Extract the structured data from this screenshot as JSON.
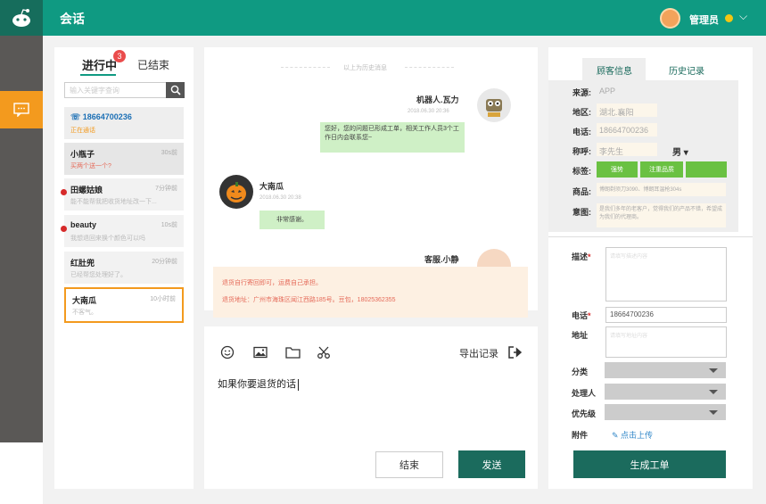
{
  "header": {
    "title": "会话",
    "admin_name": "管理员",
    "dropdown_icon": "chevron-down-icon",
    "status_color": "#f3c613"
  },
  "conv_tabs": {
    "active": "进行中",
    "badge": "3",
    "ended": "已结束"
  },
  "search": {
    "placeholder": "输入关键字查询"
  },
  "conversations": [
    {
      "name": "18664700236",
      "time": "",
      "msg": "正在通话"
    },
    {
      "name": "小瓶子",
      "time": "30s前",
      "msg": "买两个送一个?"
    },
    {
      "name": "田螺姑娘",
      "time": "7分钟前",
      "msg": "能不能帮我把收货地址改一下..."
    },
    {
      "name": "beauty",
      "time": "10s前",
      "msg": "我想退回来换个颜色可以吗"
    },
    {
      "name": "红肚兜",
      "time": "20分钟前",
      "msg": "已经帮您处理好了。"
    },
    {
      "name": "大南瓜",
      "time": "10小时前",
      "msg": "不客气。"
    }
  ],
  "chat": {
    "history_label": "以上为历史消息",
    "robot_name": "机器人.瓦力",
    "robot_time": "2018.06.30  20:36",
    "robot_msg": "您好，您的问题已形成工单，相关工作人员3个工作日内会联系您~",
    "user_name": "大南瓜",
    "user_time": "2018.06.30  20:38",
    "user_msg": "非常感谢。",
    "agent_name": "客服.小静",
    "notice_line1": "退货自行寄回即可，运费自己承担。",
    "notice_line2": "退货地址：广州市海珠区闻江西路185号。豆包，18025362355"
  },
  "composer": {
    "export_label": "导出记录",
    "draft": "如果你要退货的话",
    "end_label": "结束",
    "send_label": "发送"
  },
  "right_tabs": {
    "customer": "顾客信息",
    "history": "历史记录"
  },
  "customer": {
    "source_label": "来源:",
    "source": "APP",
    "region_label": "地区:",
    "region": "湖北.襄阳",
    "phone_label": "电话:",
    "phone": "18664700236",
    "title_label": "称呼:",
    "title": "李先生",
    "gender": "男",
    "tags_label": "标签:",
    "tags": [
      "强势",
      "注重品质",
      ""
    ],
    "product_label": "商品:",
    "product": "博朗剃须刀3090、博朗耳温枪304s",
    "intent_label": "意图:",
    "intent": "是我们多年的老客户，觉得我们的产品不错，希望成为我们的代理商。"
  },
  "ticket": {
    "desc_label": "描述",
    "desc_placeholder": "请填写描述内容",
    "phone_label": "电话",
    "phone_value": "18664700236",
    "address_label": "地址",
    "address_placeholder": "请填写地址内容",
    "category_label": "分类",
    "handler_label": "处理人",
    "priority_label": "优先级",
    "attachment_label": "附件",
    "upload_label": "点击上传",
    "create_label": "生成工单"
  }
}
